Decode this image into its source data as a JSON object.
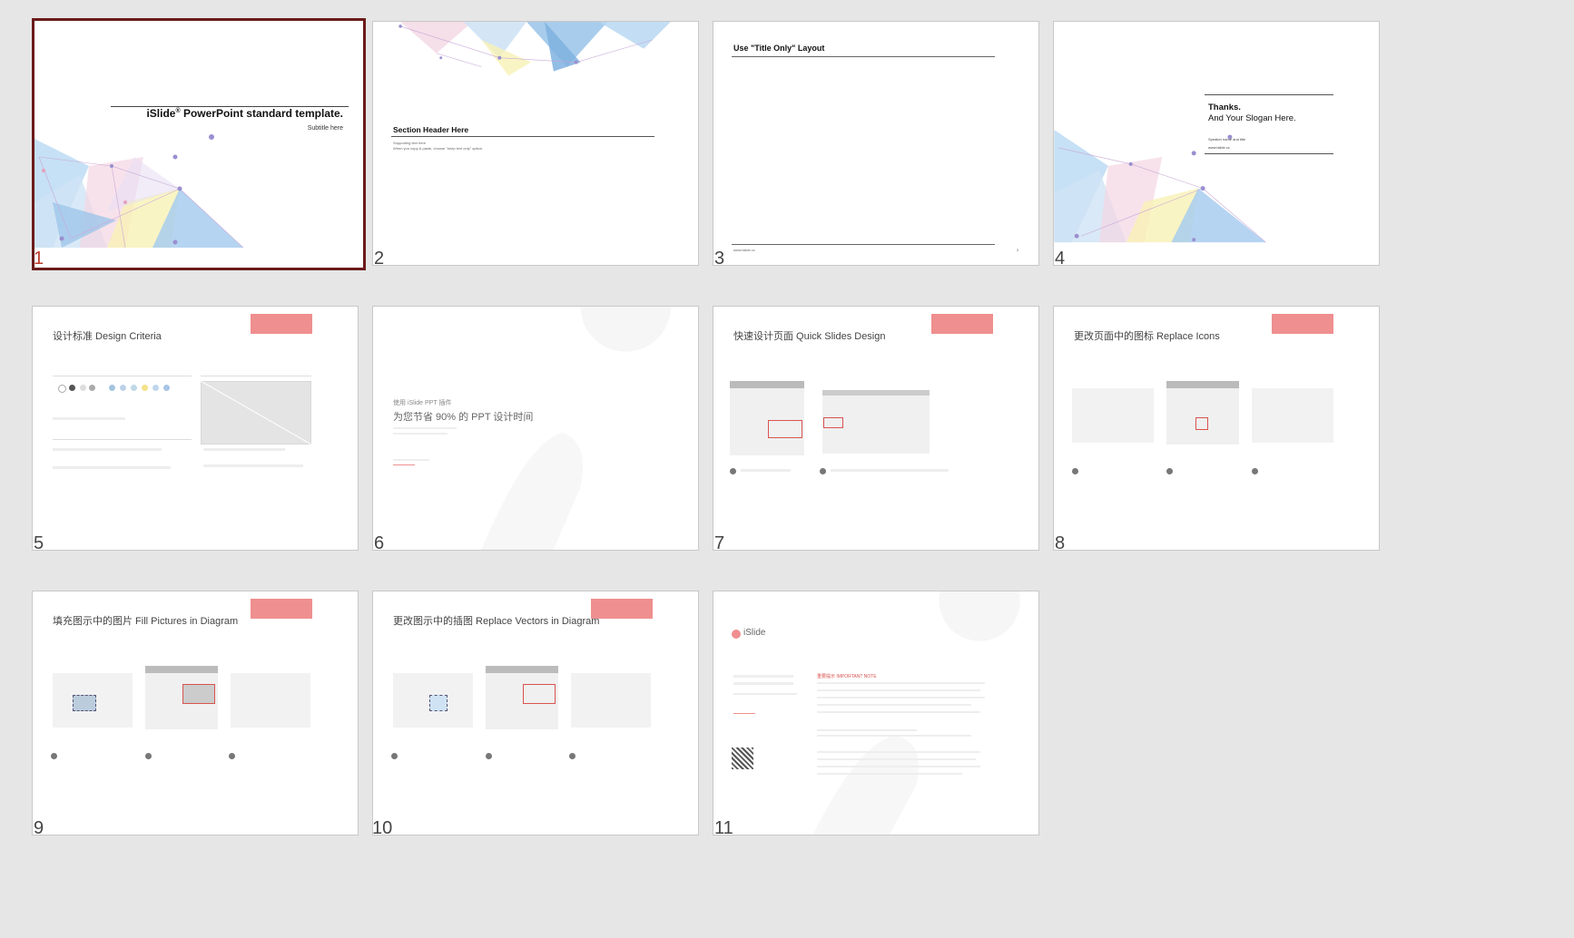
{
  "slides": [
    {
      "num": "1",
      "title": "iSlide",
      "title_sup": "®",
      "title_rest": " PowerPoint standard template.",
      "subtitle": "Subtitle here"
    },
    {
      "num": "2",
      "title": "Section Header Here",
      "line1": "Supporting text here",
      "line2": "When you copy & paste, choose \"keep text only\" option."
    },
    {
      "num": "3",
      "title": "Use \"Title Only\" Layout",
      "footer_left": "www.islide.cc",
      "footer_right": "3"
    },
    {
      "num": "4",
      "line1": "Thanks.",
      "line2": "And Your Slogan Here.",
      "speaker": "Speaker name and title",
      "url": "www.islide.cc"
    },
    {
      "num": "5",
      "title": "设计标准 Design Criteria"
    },
    {
      "num": "6",
      "line1": "使用 iSlide PPT 插件",
      "line2": "为您节省 90% 的 PPT 设计时间"
    },
    {
      "num": "7",
      "title": "快速设计页面  Quick Slides Design"
    },
    {
      "num": "8",
      "title": "更改页面中的图标  Replace Icons"
    },
    {
      "num": "9",
      "title": "填充图示中的图片  Fill Pictures in Diagram"
    },
    {
      "num": "10",
      "title": "更改图示中的插图  Replace Vectors in Diagram"
    },
    {
      "num": "11",
      "brand": "iSlide",
      "important": "重要提示 IMPORTANT NOTE"
    }
  ],
  "colors": {
    "selected_border": "#6b1b1b",
    "selected_number": "#c0392b",
    "accent_pink": "#ef8f8f"
  }
}
